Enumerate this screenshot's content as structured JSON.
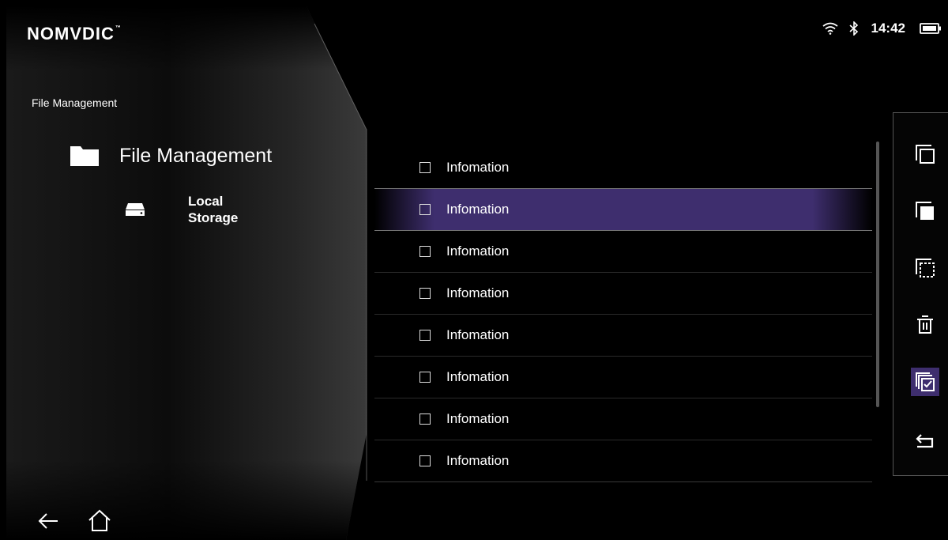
{
  "brand": {
    "logo_text": "NOMVDIC",
    "trademark": "™"
  },
  "status": {
    "time": "14:42",
    "wifi_icon": "wifi-icon",
    "bluetooth_icon": "bluetooth-icon",
    "battery_icon": "battery-icon"
  },
  "breadcrumb": "File Management",
  "tree": {
    "root_label": "File Management",
    "child_label": "Local\nStorage"
  },
  "files": [
    {
      "name": "Infomation",
      "checked": false,
      "selected": false
    },
    {
      "name": "Infomation",
      "checked": false,
      "selected": true
    },
    {
      "name": "Infomation",
      "checked": false,
      "selected": false
    },
    {
      "name": "Infomation",
      "checked": false,
      "selected": false
    },
    {
      "name": "Infomation",
      "checked": false,
      "selected": false
    },
    {
      "name": "Infomation",
      "checked": false,
      "selected": false
    },
    {
      "name": "Infomation",
      "checked": false,
      "selected": false
    },
    {
      "name": "Infomation",
      "checked": false,
      "selected": false
    }
  ],
  "toolbar": [
    {
      "icon": "copy-icon",
      "active": false
    },
    {
      "icon": "copy-filled-icon",
      "active": false
    },
    {
      "icon": "cut-icon",
      "active": false
    },
    {
      "icon": "delete-icon",
      "active": false
    },
    {
      "icon": "select-all-icon",
      "active": true
    },
    {
      "icon": "return-icon",
      "active": false
    }
  ],
  "nav": {
    "back_icon": "back-arrow-icon",
    "home_icon": "home-icon"
  },
  "colors": {
    "background": "#000000",
    "highlight": "#3e2e6e",
    "text": "#ffffff"
  }
}
